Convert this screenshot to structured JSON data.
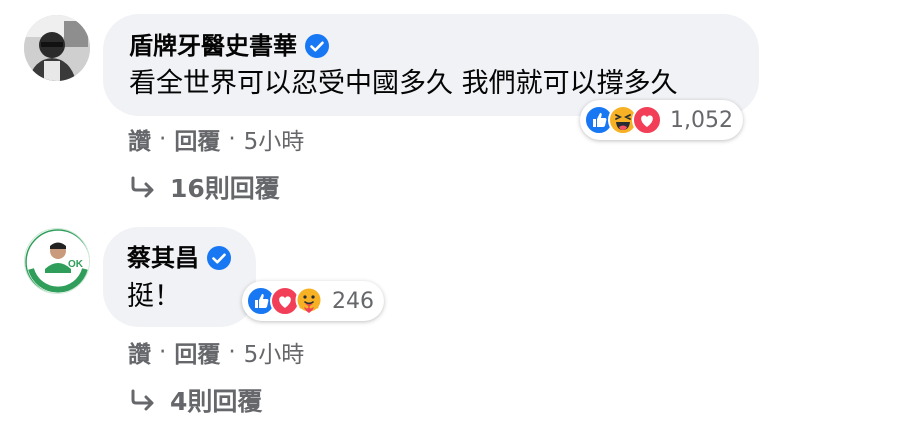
{
  "colors": {
    "bubble": "#f0f2f5",
    "secondary_text": "#65676b",
    "verified_blue": "#1877f2",
    "like_blue": "#1877f2",
    "love_red": "#f33e58",
    "haha_yellow": "#f7b125"
  },
  "comments": [
    {
      "author": "盾牌牙醫史書華",
      "verified_icon": "verified-badge-icon",
      "text": "看全世界可以忍受中國多久 我們就可以撐多久",
      "reactions": {
        "icons": [
          "like-icon",
          "haha-icon",
          "love-icon"
        ],
        "count": "1,052"
      },
      "actions": {
        "like": "讚",
        "reply": "回覆",
        "time": "5小時"
      },
      "replies_link": "16則回覆"
    },
    {
      "author": "蔡其昌",
      "verified_icon": "verified-badge-icon",
      "text": "挺！",
      "reactions": {
        "icons": [
          "like-icon",
          "love-icon",
          "care-icon"
        ],
        "count": "246"
      },
      "actions": {
        "like": "讚",
        "reply": "回覆",
        "time": "5小時"
      },
      "replies_link": "4則回覆"
    }
  ],
  "separator": "·"
}
